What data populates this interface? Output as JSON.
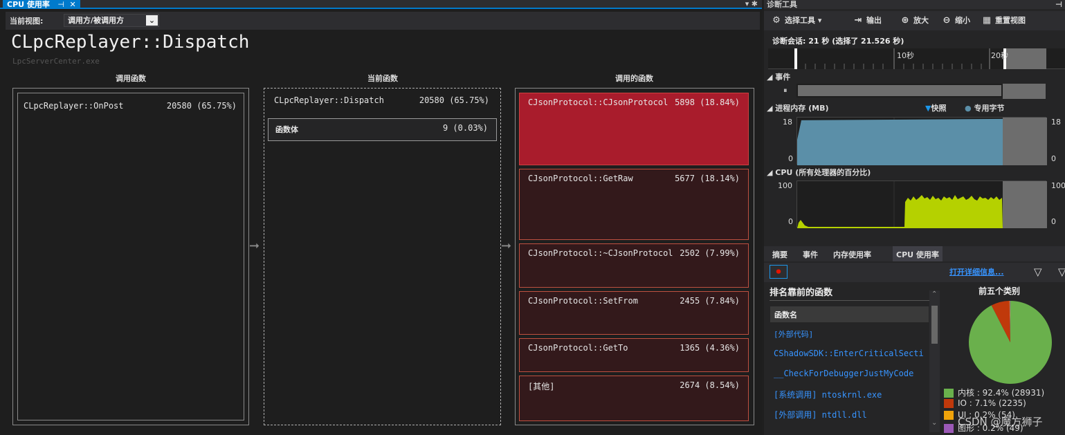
{
  "tab": {
    "label": "CPU 使用率"
  },
  "view": {
    "label": "当前视图:",
    "value": "调用方/被调用方"
  },
  "func": {
    "title": "CLpcReplayer::Dispatch",
    "module": "LpcServerCenter.exe"
  },
  "columns": {
    "callers": "调用函数",
    "current": "当前函数",
    "callees": "调用的函数"
  },
  "callers": [
    {
      "name": "CLpcReplayer::OnPost",
      "value": "20580 (65.75%)"
    }
  ],
  "current": {
    "name": "CLpcReplayer::Dispatch",
    "value": "20580 (65.75%)",
    "body_label": "函数体",
    "body_value": "9 (0.03%)"
  },
  "callees": [
    {
      "name": "CJsonProtocol::CJsonProtocol",
      "value": "5898 (18.84%)"
    },
    {
      "name": "CJsonProtocol::GetRaw",
      "value": "5677 (18.14%)"
    },
    {
      "name": "CJsonProtocol::~CJsonProtocol",
      "value": "2502 (7.99%)"
    },
    {
      "name": "CJsonProtocol::SetFrom",
      "value": "2455 (7.84%)"
    },
    {
      "name": "CJsonProtocol::GetTo",
      "value": "1365 (4.36%)"
    },
    {
      "name": "[其他]",
      "value": "2674 (8.54%)"
    }
  ],
  "diag": {
    "title": "诊断工具",
    "toolbar": {
      "select": "选择工具",
      "output": "输出",
      "zoomin": "放大",
      "zoomout": "缩小",
      "reset": "重置视图"
    },
    "session": "诊断会话: 21 秒 (选择了 21.526 秒)",
    "ruler": {
      "t10": "10秒",
      "t20": "20秒"
    },
    "events": "事件",
    "memory": {
      "label": "进程内存 (MB)",
      "snapshot": "快照",
      "private": "专用字节",
      "max": "18",
      "min": "0",
      "level_mb": 17.5
    },
    "cpu": {
      "label": "CPU (所有处理器的百分比)",
      "max": "100",
      "min": "0"
    },
    "tabs": {
      "summary": "摘要",
      "events": "事件",
      "memory": "内存使用率",
      "cpu": "CPU 使用率"
    },
    "detail_link": "打开详细信息...",
    "top_funcs_title": "排名靠前的函数",
    "top_cats_title": "前五个类别",
    "fn_header": "函数名",
    "functions": [
      "[外部代码]",
      "CShadowSDK::EnterCriticalSecti",
      "__CheckForDebuggerJustMyCode",
      "[系统调用] ntoskrnl.exe",
      "[外部调用] ntdll.dll"
    ],
    "categories": [
      {
        "label": "内核 : 92.4% (28931)",
        "color": "#6ab04c",
        "pct": 92.4
      },
      {
        "label": "IO : 7.1% (2235)",
        "color": "#c0390b",
        "pct": 7.1
      },
      {
        "label": "UI : 0.2% (54)",
        "color": "#f0a30a",
        "pct": 0.2
      },
      {
        "label": "图形 : 0.2% (49)",
        "color": "#9b59b6",
        "pct": 0.2
      }
    ],
    "colors": {
      "cpu": "#b5d100",
      "memory": "#5b8fa8",
      "accent": "#007acc",
      "hot": "#a91c2c"
    }
  },
  "watermark": "CSDN @魔方狮子"
}
